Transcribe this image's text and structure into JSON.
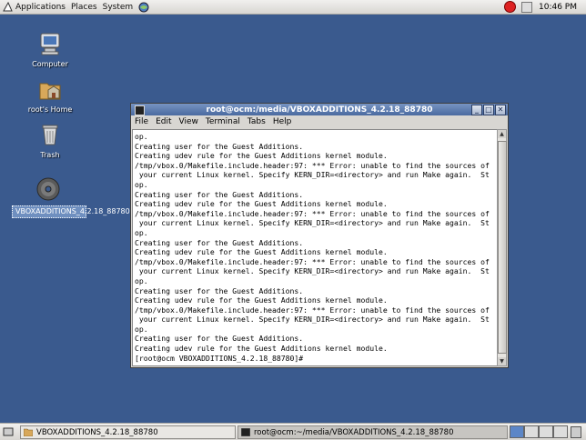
{
  "top_panel": {
    "menus": [
      "Applications",
      "Places",
      "System"
    ],
    "clock": "10:46 PM"
  },
  "desktop": {
    "icons": [
      {
        "label": "Computer"
      },
      {
        "label": "root's Home"
      },
      {
        "label": "Trash"
      },
      {
        "label": "VBOXADDITIONS_4.2.18_88780"
      }
    ]
  },
  "terminal": {
    "title": "root@ocm:/media/VBOXADDITIONS_4.2.18_88780",
    "menu": [
      "File",
      "Edit",
      "View",
      "Terminal",
      "Tabs",
      "Help"
    ],
    "lines": [
      "op.",
      "Creating user for the Guest Additions.",
      "Creating udev rule for the Guest Additions kernel module.",
      "/tmp/vbox.0/Makefile.include.header:97: *** Error: unable to find the sources of",
      " your current Linux kernel. Specify KERN_DIR=<directory> and run Make again.  St",
      "op.",
      "Creating user for the Guest Additions.",
      "Creating udev rule for the Guest Additions kernel module.",
      "/tmp/vbox.0/Makefile.include.header:97: *** Error: unable to find the sources of",
      " your current Linux kernel. Specify KERN_DIR=<directory> and run Make again.  St",
      "op.",
      "Creating user for the Guest Additions.",
      "Creating udev rule for the Guest Additions kernel module.",
      "/tmp/vbox.0/Makefile.include.header:97: *** Error: unable to find the sources of",
      " your current Linux kernel. Specify KERN_DIR=<directory> and run Make again.  St",
      "op.",
      "Creating user for the Guest Additions.",
      "Creating udev rule for the Guest Additions kernel module.",
      "/tmp/vbox.0/Makefile.include.header:97: *** Error: unable to find the sources of",
      " your current Linux kernel. Specify KERN_DIR=<directory> and run Make again.  St",
      "op.",
      "Creating user for the Guest Additions.",
      "Creating udev rule for the Guest Additions kernel module.",
      "[root@ocm VBOXADDITIONS_4.2.18_88780]#"
    ]
  },
  "taskbar": {
    "tasks": [
      {
        "label": "VBOXADDITIONS_4.2.18_88780",
        "icon": "folder-icon"
      },
      {
        "label": "root@ocm:~/media/VBOXADDITIONS_4.2.18_88780",
        "icon": "terminal-icon"
      }
    ]
  },
  "colors": {
    "desktop": "#3a5a8e",
    "titlebar": "#5a78ad"
  }
}
